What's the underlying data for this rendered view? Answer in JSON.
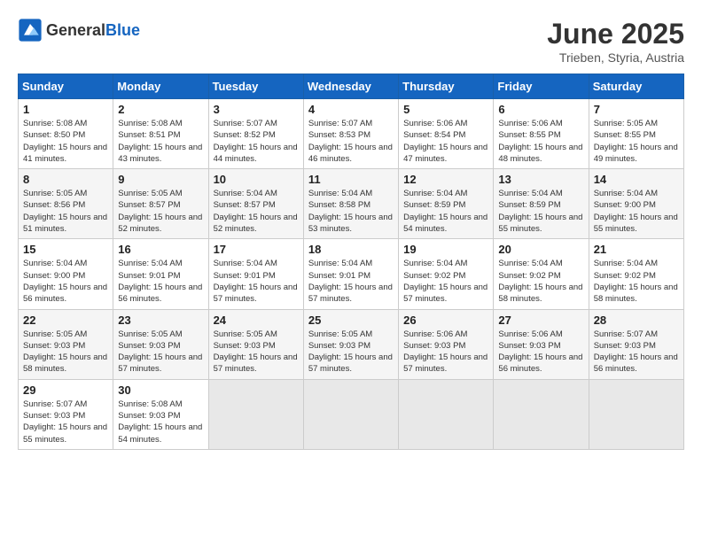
{
  "header": {
    "logo_general": "General",
    "logo_blue": "Blue",
    "title": "June 2025",
    "location": "Trieben, Styria, Austria"
  },
  "calendar": {
    "days_of_week": [
      "Sunday",
      "Monday",
      "Tuesday",
      "Wednesday",
      "Thursday",
      "Friday",
      "Saturday"
    ],
    "weeks": [
      [
        null,
        {
          "day": 2,
          "sunrise": "5:08 AM",
          "sunset": "8:51 PM",
          "daylight": "15 hours and 43 minutes."
        },
        {
          "day": 3,
          "sunrise": "5:07 AM",
          "sunset": "8:52 PM",
          "daylight": "15 hours and 44 minutes."
        },
        {
          "day": 4,
          "sunrise": "5:07 AM",
          "sunset": "8:53 PM",
          "daylight": "15 hours and 46 minutes."
        },
        {
          "day": 5,
          "sunrise": "5:06 AM",
          "sunset": "8:54 PM",
          "daylight": "15 hours and 47 minutes."
        },
        {
          "day": 6,
          "sunrise": "5:06 AM",
          "sunset": "8:55 PM",
          "daylight": "15 hours and 48 minutes."
        },
        {
          "day": 7,
          "sunrise": "5:05 AM",
          "sunset": "8:55 PM",
          "daylight": "15 hours and 49 minutes."
        }
      ],
      [
        {
          "day": 1,
          "sunrise": "5:08 AM",
          "sunset": "8:50 PM",
          "daylight": "15 hours and 41 minutes."
        },
        {
          "day": 9,
          "sunrise": "5:05 AM",
          "sunset": "8:57 PM",
          "daylight": "15 hours and 52 minutes."
        },
        {
          "day": 10,
          "sunrise": "5:04 AM",
          "sunset": "8:57 PM",
          "daylight": "15 hours and 52 minutes."
        },
        {
          "day": 11,
          "sunrise": "5:04 AM",
          "sunset": "8:58 PM",
          "daylight": "15 hours and 53 minutes."
        },
        {
          "day": 12,
          "sunrise": "5:04 AM",
          "sunset": "8:59 PM",
          "daylight": "15 hours and 54 minutes."
        },
        {
          "day": 13,
          "sunrise": "5:04 AM",
          "sunset": "8:59 PM",
          "daylight": "15 hours and 55 minutes."
        },
        {
          "day": 14,
          "sunrise": "5:04 AM",
          "sunset": "9:00 PM",
          "daylight": "15 hours and 55 minutes."
        }
      ],
      [
        {
          "day": 8,
          "sunrise": "5:05 AM",
          "sunset": "8:56 PM",
          "daylight": "15 hours and 51 minutes."
        },
        {
          "day": 16,
          "sunrise": "5:04 AM",
          "sunset": "9:01 PM",
          "daylight": "15 hours and 56 minutes."
        },
        {
          "day": 17,
          "sunrise": "5:04 AM",
          "sunset": "9:01 PM",
          "daylight": "15 hours and 57 minutes."
        },
        {
          "day": 18,
          "sunrise": "5:04 AM",
          "sunset": "9:01 PM",
          "daylight": "15 hours and 57 minutes."
        },
        {
          "day": 19,
          "sunrise": "5:04 AM",
          "sunset": "9:02 PM",
          "daylight": "15 hours and 57 minutes."
        },
        {
          "day": 20,
          "sunrise": "5:04 AM",
          "sunset": "9:02 PM",
          "daylight": "15 hours and 58 minutes."
        },
        {
          "day": 21,
          "sunrise": "5:04 AM",
          "sunset": "9:02 PM",
          "daylight": "15 hours and 58 minutes."
        }
      ],
      [
        {
          "day": 15,
          "sunrise": "5:04 AM",
          "sunset": "9:00 PM",
          "daylight": "15 hours and 56 minutes."
        },
        {
          "day": 23,
          "sunrise": "5:05 AM",
          "sunset": "9:03 PM",
          "daylight": "15 hours and 57 minutes."
        },
        {
          "day": 24,
          "sunrise": "5:05 AM",
          "sunset": "9:03 PM",
          "daylight": "15 hours and 57 minutes."
        },
        {
          "day": 25,
          "sunrise": "5:05 AM",
          "sunset": "9:03 PM",
          "daylight": "15 hours and 57 minutes."
        },
        {
          "day": 26,
          "sunrise": "5:06 AM",
          "sunset": "9:03 PM",
          "daylight": "15 hours and 57 minutes."
        },
        {
          "day": 27,
          "sunrise": "5:06 AM",
          "sunset": "9:03 PM",
          "daylight": "15 hours and 56 minutes."
        },
        {
          "day": 28,
          "sunrise": "5:07 AM",
          "sunset": "9:03 PM",
          "daylight": "15 hours and 56 minutes."
        }
      ],
      [
        {
          "day": 22,
          "sunrise": "5:05 AM",
          "sunset": "9:03 PM",
          "daylight": "15 hours and 58 minutes."
        },
        {
          "day": 30,
          "sunrise": "5:08 AM",
          "sunset": "9:03 PM",
          "daylight": "15 hours and 54 minutes."
        },
        null,
        null,
        null,
        null,
        null
      ],
      [
        {
          "day": 29,
          "sunrise": "5:07 AM",
          "sunset": "9:03 PM",
          "daylight": "15 hours and 55 minutes."
        },
        null,
        null,
        null,
        null,
        null,
        null
      ]
    ]
  }
}
